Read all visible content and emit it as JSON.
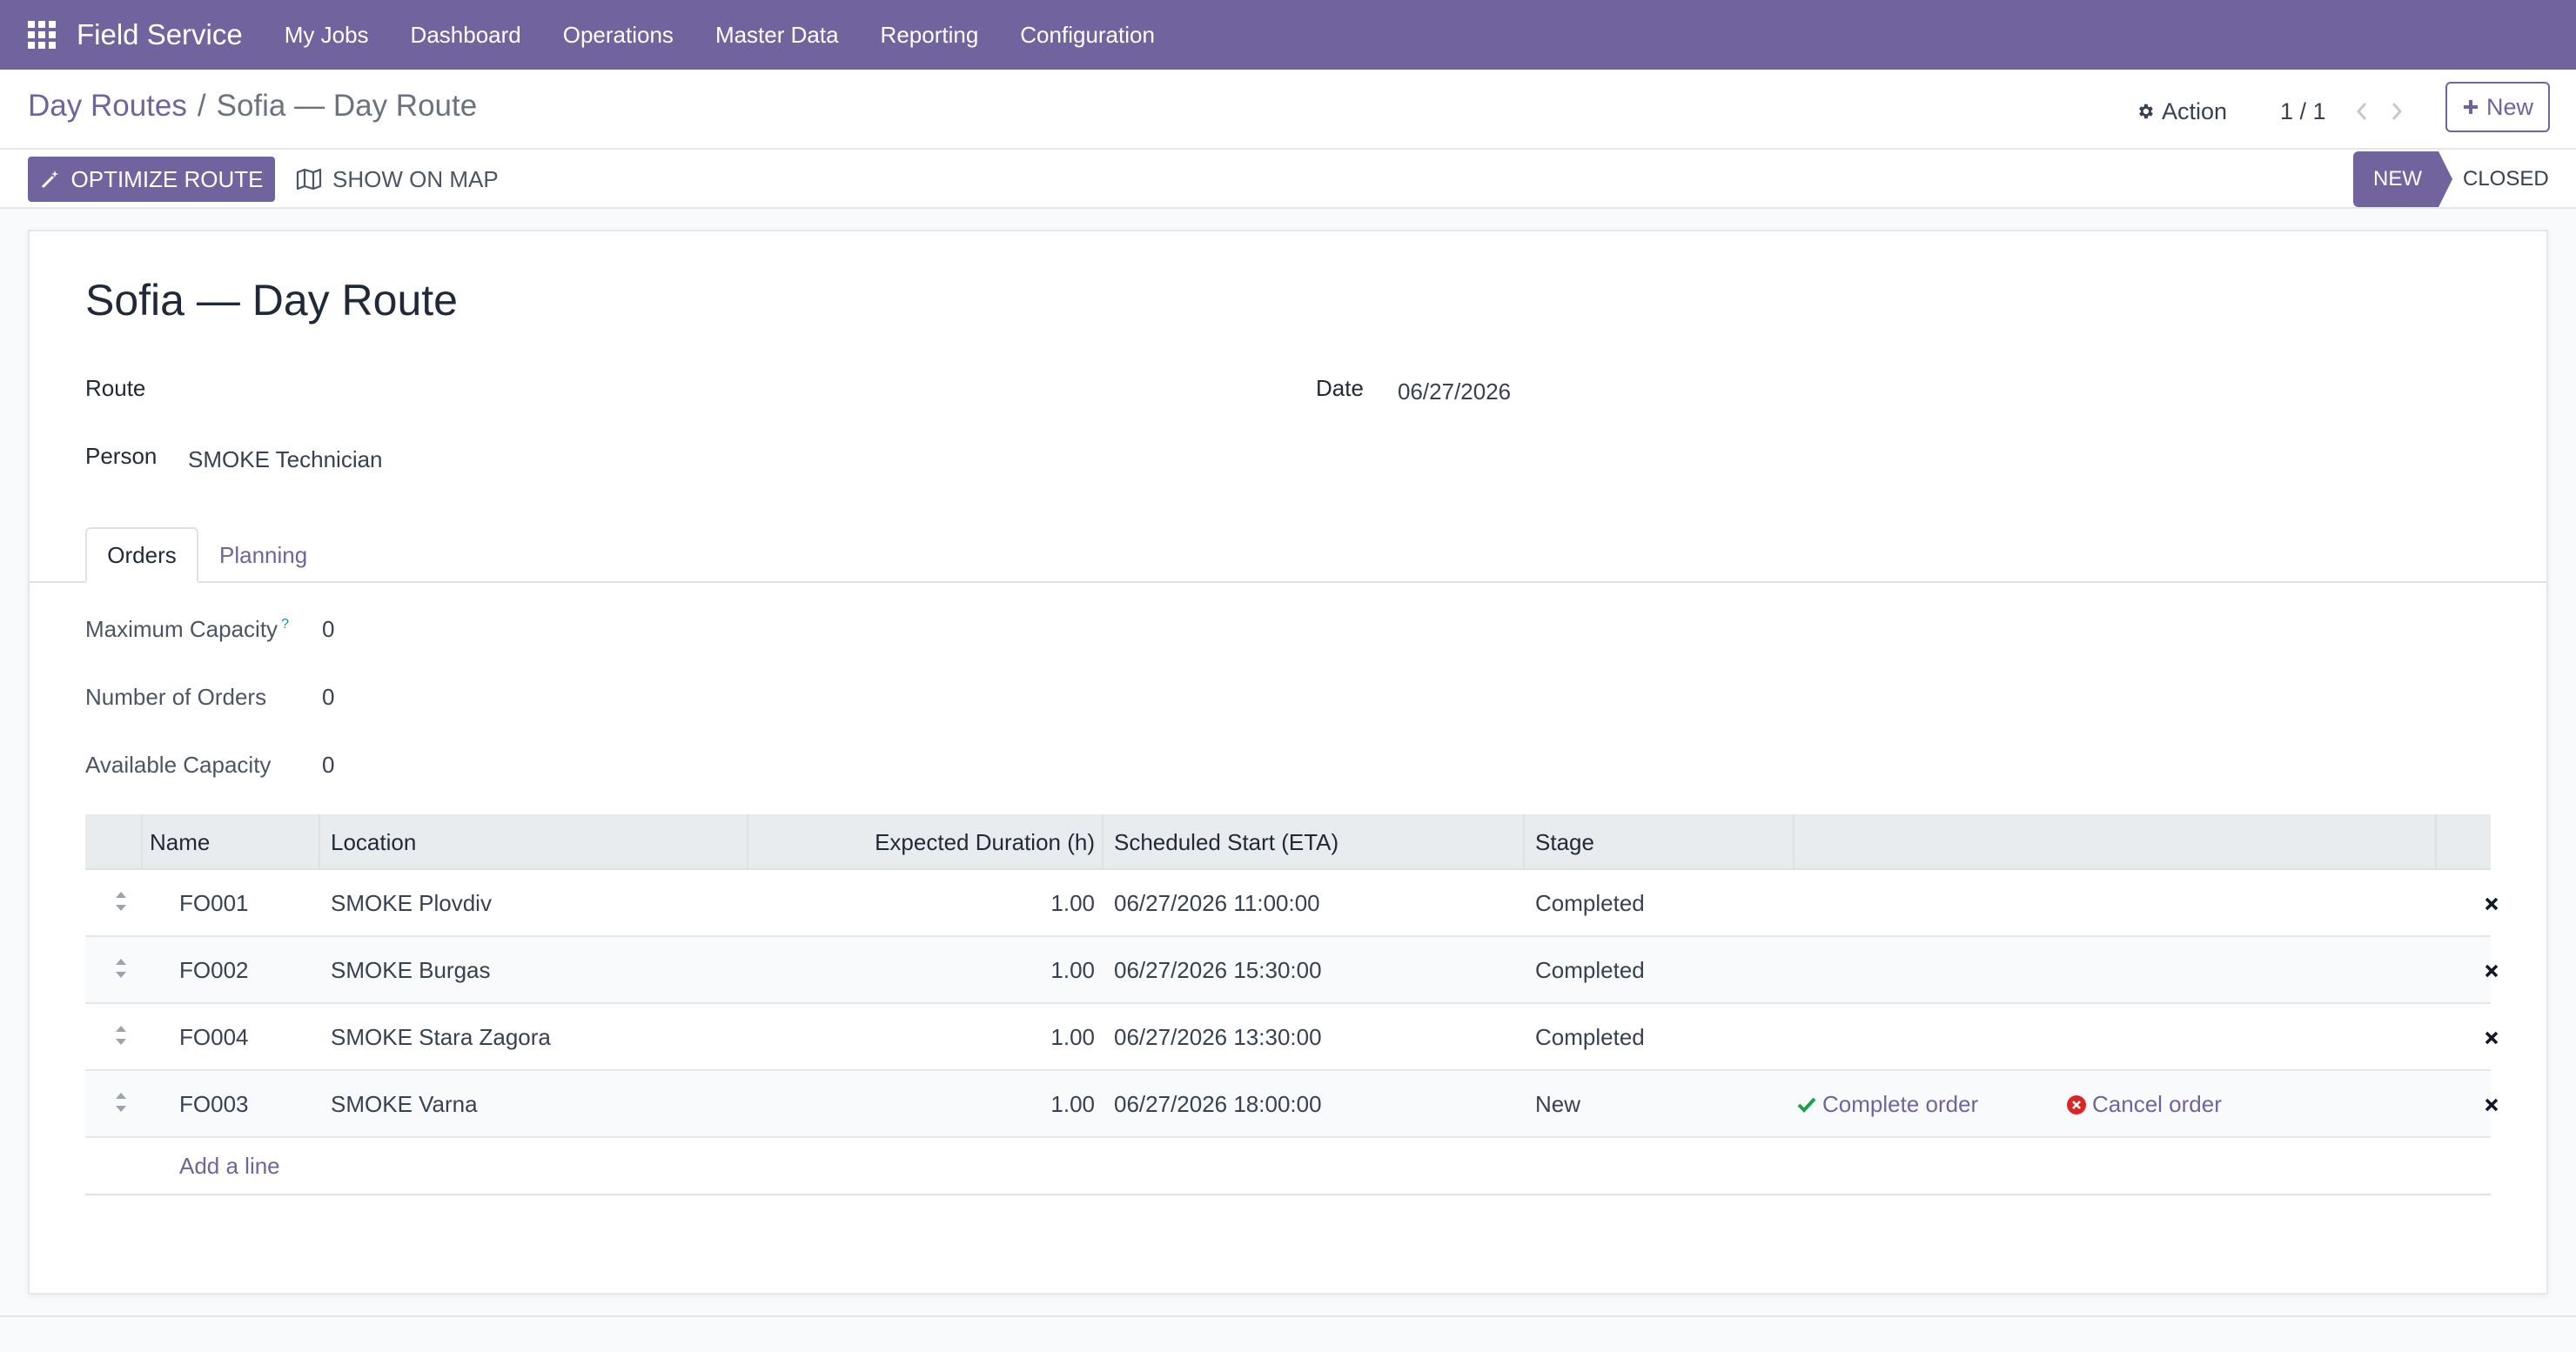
{
  "navbar": {
    "apps_icon": "grid-apps-icon",
    "brand": "Field Service",
    "items": [
      "My Jobs",
      "Dashboard",
      "Operations",
      "Master Data",
      "Reporting",
      "Configuration"
    ]
  },
  "control": {
    "breadcrumb": {
      "parent": "Day Routes",
      "separator": "/",
      "current": "Sofia — Day Route"
    },
    "action_label": "Action",
    "pager": "1 / 1",
    "new_label": "New",
    "optimize_label": "OPTIMIZE ROUTE",
    "show_map_label": "SHOW ON MAP",
    "status": {
      "active": "NEW",
      "next": "CLOSED"
    }
  },
  "form": {
    "title": "Sofia — Day Route",
    "route_label": "Route",
    "route_value": "",
    "date_label": "Date",
    "date_value": "06/27/2026",
    "person_label": "Person",
    "person_value": "SMOKE Technician"
  },
  "tabs": [
    {
      "label": "Orders",
      "active": true
    },
    {
      "label": "Planning",
      "active": false
    }
  ],
  "capacity": {
    "max_label": "Maximum Capacity",
    "max_help": "?",
    "max_value": "0",
    "orders_label": "Number of Orders",
    "orders_value": "0",
    "available_label": "Available Capacity",
    "available_value": "0"
  },
  "table": {
    "headers": {
      "name": "Name",
      "location": "Location",
      "duration": "Expected Duration (h)",
      "start": "Scheduled Start (ETA)",
      "stage": "Stage"
    },
    "rows": [
      {
        "name": "FO001",
        "location": "SMOKE Plovdiv",
        "duration": "1.00",
        "start": "06/27/2026 11:00:00",
        "stage": "Completed"
      },
      {
        "name": "FO002",
        "location": "SMOKE Burgas",
        "duration": "1.00",
        "start": "06/27/2026 15:30:00",
        "stage": "Completed"
      },
      {
        "name": "FO004",
        "location": "SMOKE Stara Zagora",
        "duration": "1.00",
        "start": "06/27/2026 13:30:00",
        "stage": "Completed"
      },
      {
        "name": "FO003",
        "location": "SMOKE Varna",
        "duration": "1.00",
        "start": "06/27/2026 18:00:00",
        "stage": "New"
      }
    ],
    "complete_label": "Complete order",
    "cancel_label": "Cancel order",
    "add_line": "Add a line"
  },
  "colors": {
    "brand": "#71639e",
    "success": "#16a34a",
    "danger": "#dc2626"
  }
}
